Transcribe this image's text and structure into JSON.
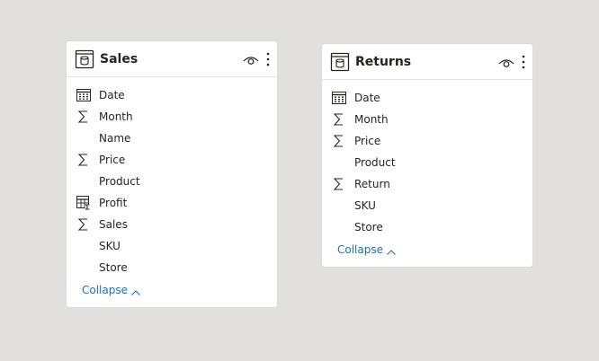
{
  "tables": [
    {
      "title": "Sales",
      "fields": [
        {
          "label": "Date",
          "icon": "calendar-icon"
        },
        {
          "label": "Month",
          "icon": "sigma-icon"
        },
        {
          "label": "Name",
          "icon": "none"
        },
        {
          "label": "Price",
          "icon": "sigma-icon"
        },
        {
          "label": "Product",
          "icon": "none"
        },
        {
          "label": "Profit",
          "icon": "calculated-table-icon"
        },
        {
          "label": "Sales",
          "icon": "sigma-icon"
        },
        {
          "label": "SKU",
          "icon": "none"
        },
        {
          "label": "Store",
          "icon": "none"
        }
      ],
      "collapse_label": "Collapse"
    },
    {
      "title": "Returns",
      "fields": [
        {
          "label": "Date",
          "icon": "calendar-icon"
        },
        {
          "label": "Month",
          "icon": "sigma-icon"
        },
        {
          "label": "Price",
          "icon": "sigma-icon"
        },
        {
          "label": "Product",
          "icon": "none"
        },
        {
          "label": "Return",
          "icon": "sigma-icon"
        },
        {
          "label": "SKU",
          "icon": "none"
        },
        {
          "label": "Store",
          "icon": "none"
        }
      ],
      "collapse_label": "Collapse"
    }
  ],
  "colors": {
    "canvas": "#e1e0df",
    "card": "#ffffff",
    "text": "#252423",
    "link": "#1e6fbd"
  }
}
